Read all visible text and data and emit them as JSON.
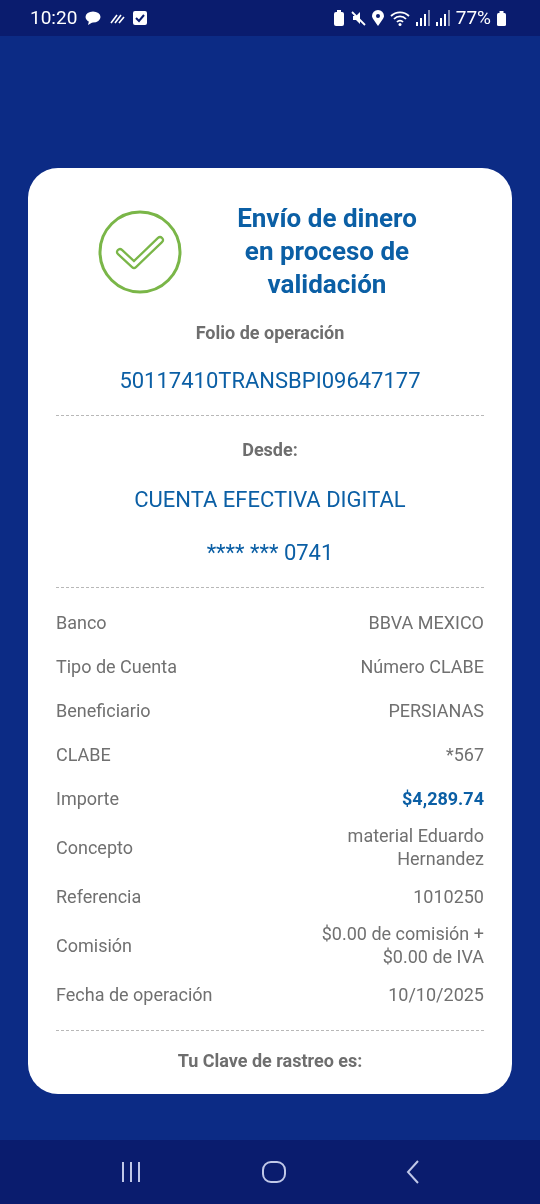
{
  "status_bar": {
    "time": "10:20",
    "battery": "77%"
  },
  "card": {
    "title": "Envío de dinero en proceso de validación",
    "folio_label": "Folio de operación",
    "folio": "50117410TRANSBPI09647177",
    "from_label": "Desde:",
    "account_name": "CUENTA EFECTIVA DIGITAL",
    "account_number": "**** *** 0741",
    "details": [
      {
        "label": "Banco",
        "value": "BBVA MEXICO",
        "kind": "plain"
      },
      {
        "label": "Tipo de Cuenta",
        "value": "Número CLABE",
        "kind": "plain"
      },
      {
        "label": "Beneficiario",
        "value": "PERSIANAS",
        "kind": "plain"
      },
      {
        "label": "CLABE",
        "value": "*567",
        "kind": "plain"
      },
      {
        "label": "Importe",
        "value": "$4,289.74",
        "kind": "amount"
      },
      {
        "label": "Concepto",
        "value": "material Eduardo Hernandez",
        "kind": "plain"
      },
      {
        "label": "Referencia",
        "value": "1010250",
        "kind": "plain"
      },
      {
        "label": "Comisión",
        "value": "$0.00 de comisión + $0.00 de IVA",
        "kind": "plain"
      },
      {
        "label": "Fecha de operación",
        "value": "10/10/2025",
        "kind": "plain"
      }
    ],
    "tracking_label": "Tu Clave de rastreo es:"
  }
}
